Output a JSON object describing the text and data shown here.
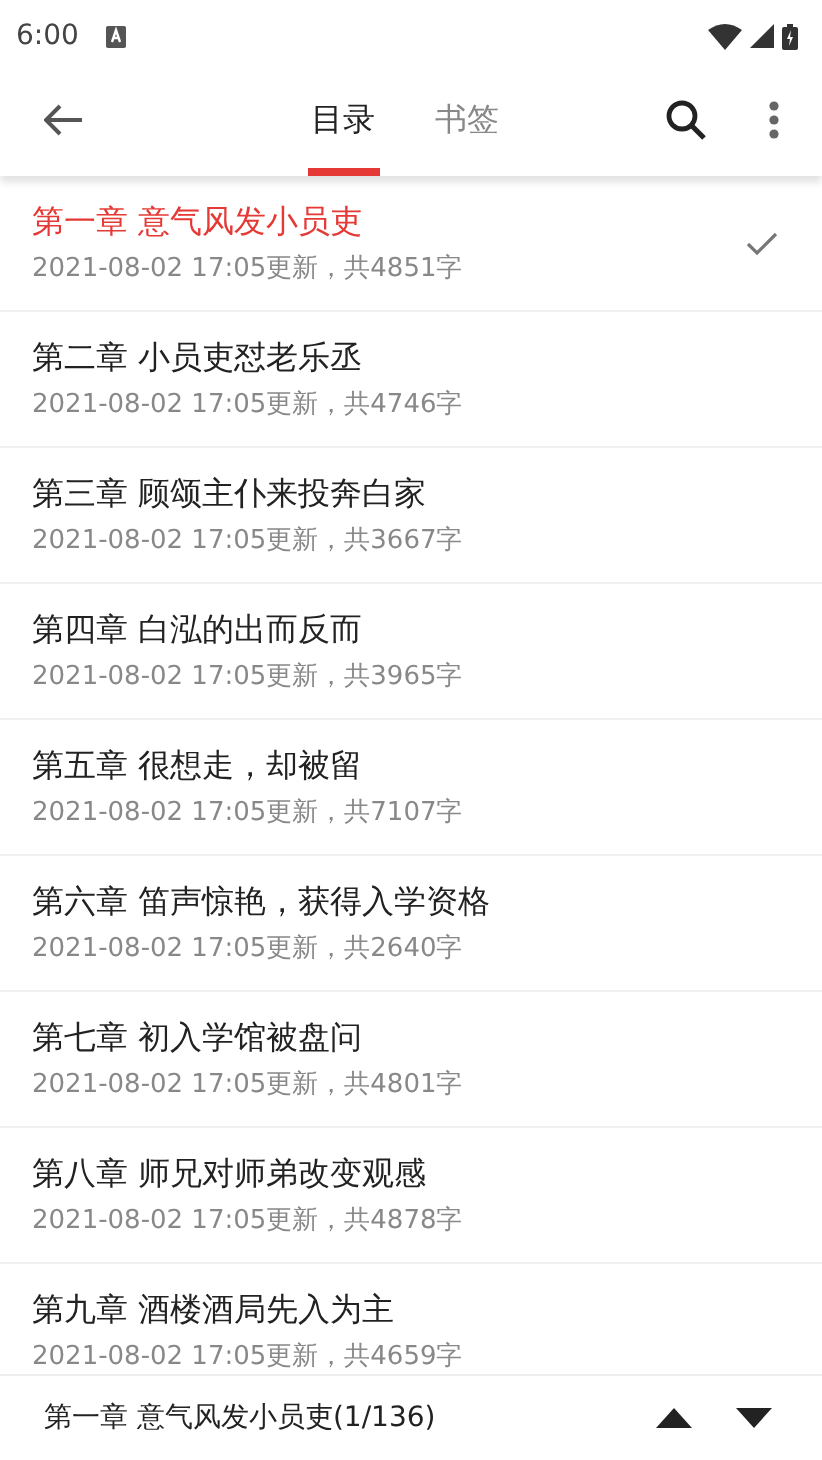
{
  "status_bar": {
    "time": "6:00"
  },
  "tabs": [
    {
      "label": "目录",
      "selected": true
    },
    {
      "label": "书签",
      "selected": false
    }
  ],
  "chapters": [
    {
      "title": "第一章 意气风发小员吏",
      "info": "2021-08-02 17:05更新，共4851字",
      "selected": true
    },
    {
      "title": "第二章 小员吏怼老乐丞",
      "info": "2021-08-02 17:05更新，共4746字",
      "selected": false
    },
    {
      "title": "第三章 顾颂主仆来投奔白家",
      "info": "2021-08-02 17:05更新，共3667字",
      "selected": false
    },
    {
      "title": "第四章 白泓的出而反而",
      "info": "2021-08-02 17:05更新，共3965字",
      "selected": false
    },
    {
      "title": "第五章 很想走，却被留",
      "info": "2021-08-02 17:05更新，共7107字",
      "selected": false
    },
    {
      "title": "第六章 笛声惊艳，获得入学资格",
      "info": "2021-08-02 17:05更新，共2640字",
      "selected": false
    },
    {
      "title": "第七章 初入学馆被盘问",
      "info": "2021-08-02 17:05更新，共4801字",
      "selected": false
    },
    {
      "title": "第八章 师兄对师弟改变观感",
      "info": "2021-08-02 17:05更新，共4878字",
      "selected": false
    },
    {
      "title": "第九章 酒楼酒局先入为主",
      "info": "2021-08-02 17:05更新，共4659字",
      "selected": false
    }
  ],
  "bottom_bar": {
    "current": "第一章 意气风发小员吏(1/136)"
  }
}
